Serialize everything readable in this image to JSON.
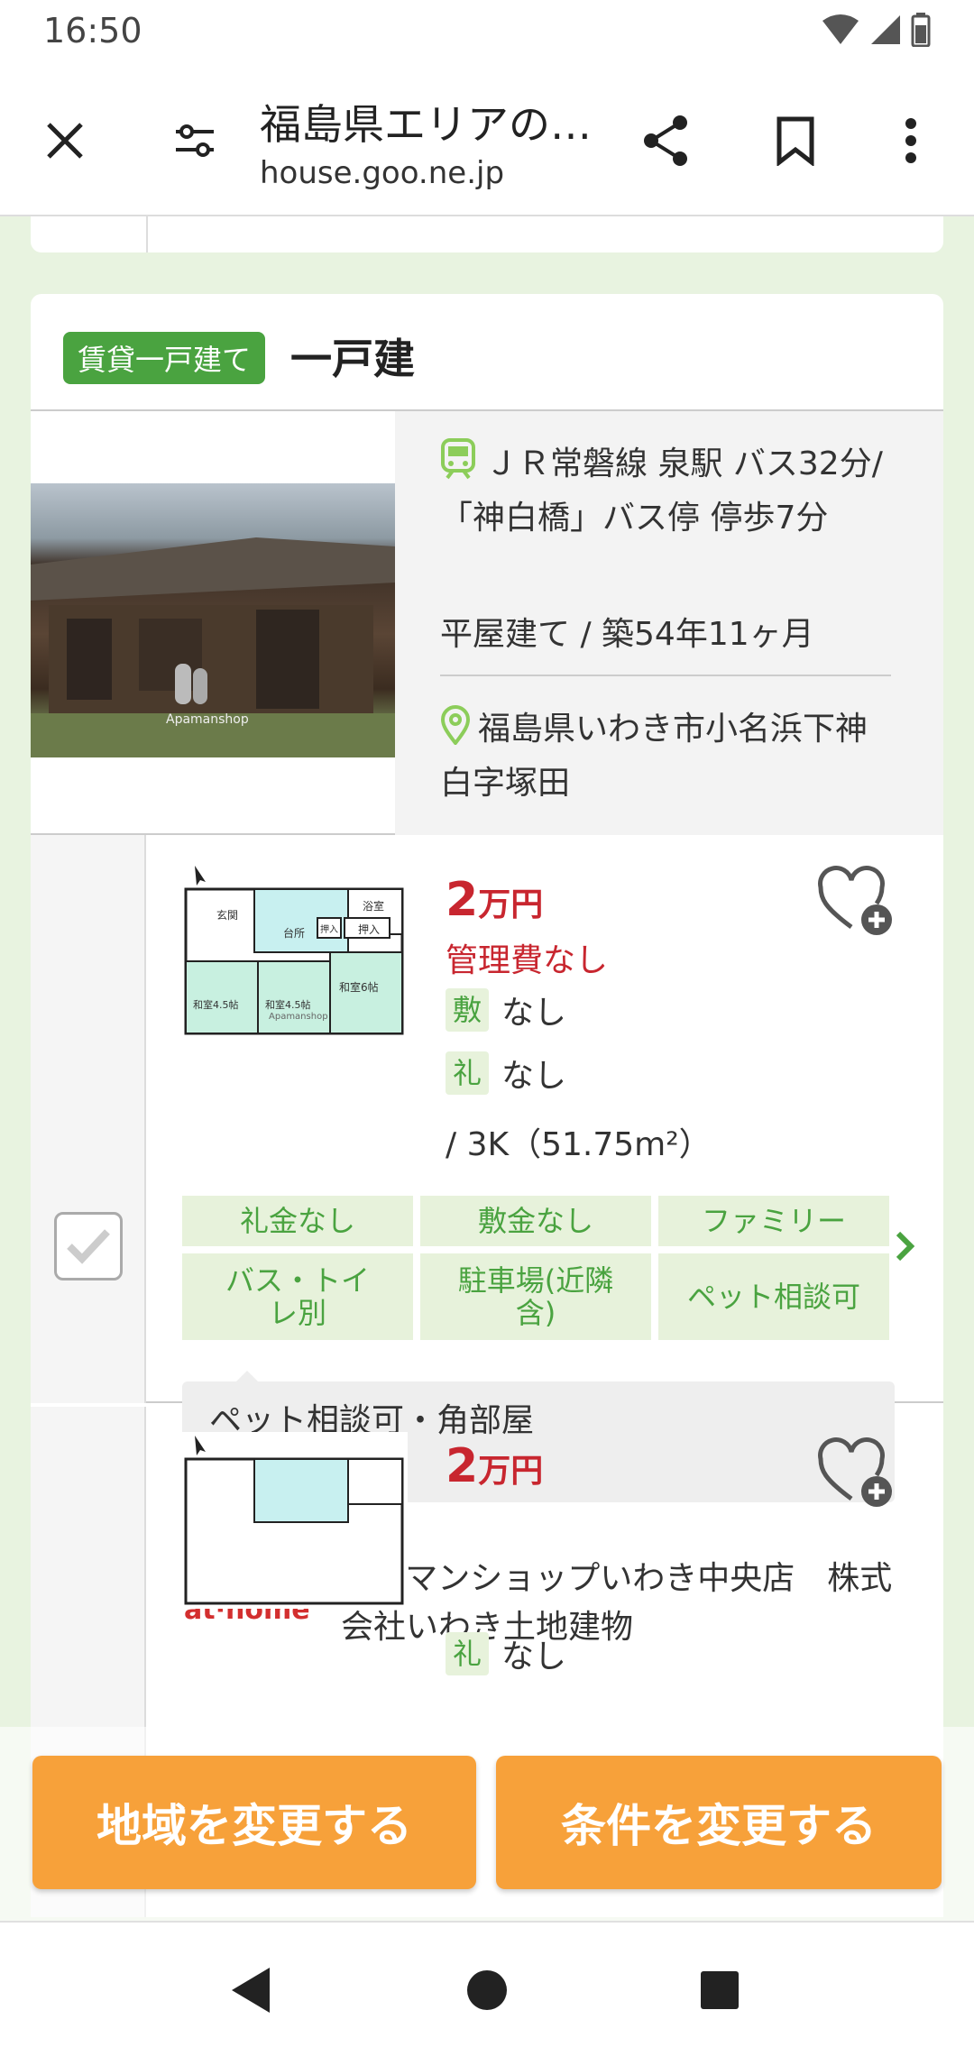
{
  "status_bar": {
    "time": "16:50"
  },
  "toolbar": {
    "title": "福島県エリアの…",
    "url": "house.goo.ne.jp"
  },
  "card": {
    "badge": "賃貸一戸建て",
    "title": "一戸建",
    "station": "ＪＲ常磐線 泉駅 バス32分/「神白橋」バス停 停歩7分",
    "building": "平屋建て / 築54年11ヶ月",
    "address": "福島県いわき市小名浜下神白字塚田",
    "photo_watermark": "Apamanshop"
  },
  "listing": {
    "price_num": "2",
    "price_unit": "万円",
    "management": "管理費なし",
    "shikikin_label": "敷",
    "shikikin_value": "なし",
    "reikin_label": "礼",
    "reikin_value": "なし",
    "size": "/ 3K（51.75m²）",
    "tags": [
      "礼金なし",
      "敷金なし",
      "ファミリー",
      "バス・トイレ別",
      "駐車場(近隣含)",
      "ペット相談可"
    ],
    "note": "ペット相談可・角部屋",
    "agency_logo": "at·home",
    "agency_name": "アパマンショップいわき中央店　株式会社いわき土地建物",
    "floorplan_labels": [
      "玄関",
      "台所",
      "浴室",
      "押入",
      "押入",
      "和室4.5帖",
      "和室4.5帖",
      "和室6帖",
      "Apamanshop"
    ]
  },
  "next_listing": {
    "price_num": "2",
    "price_unit": "万円",
    "reikin_label": "礼",
    "reikin_value": "なし"
  },
  "actions": {
    "area_button": "地域を変更する",
    "condition_button": "条件を変更する"
  },
  "colors": {
    "accent_green": "#4aa340",
    "price_red": "#c8262f",
    "action_orange": "#f7a13a"
  }
}
